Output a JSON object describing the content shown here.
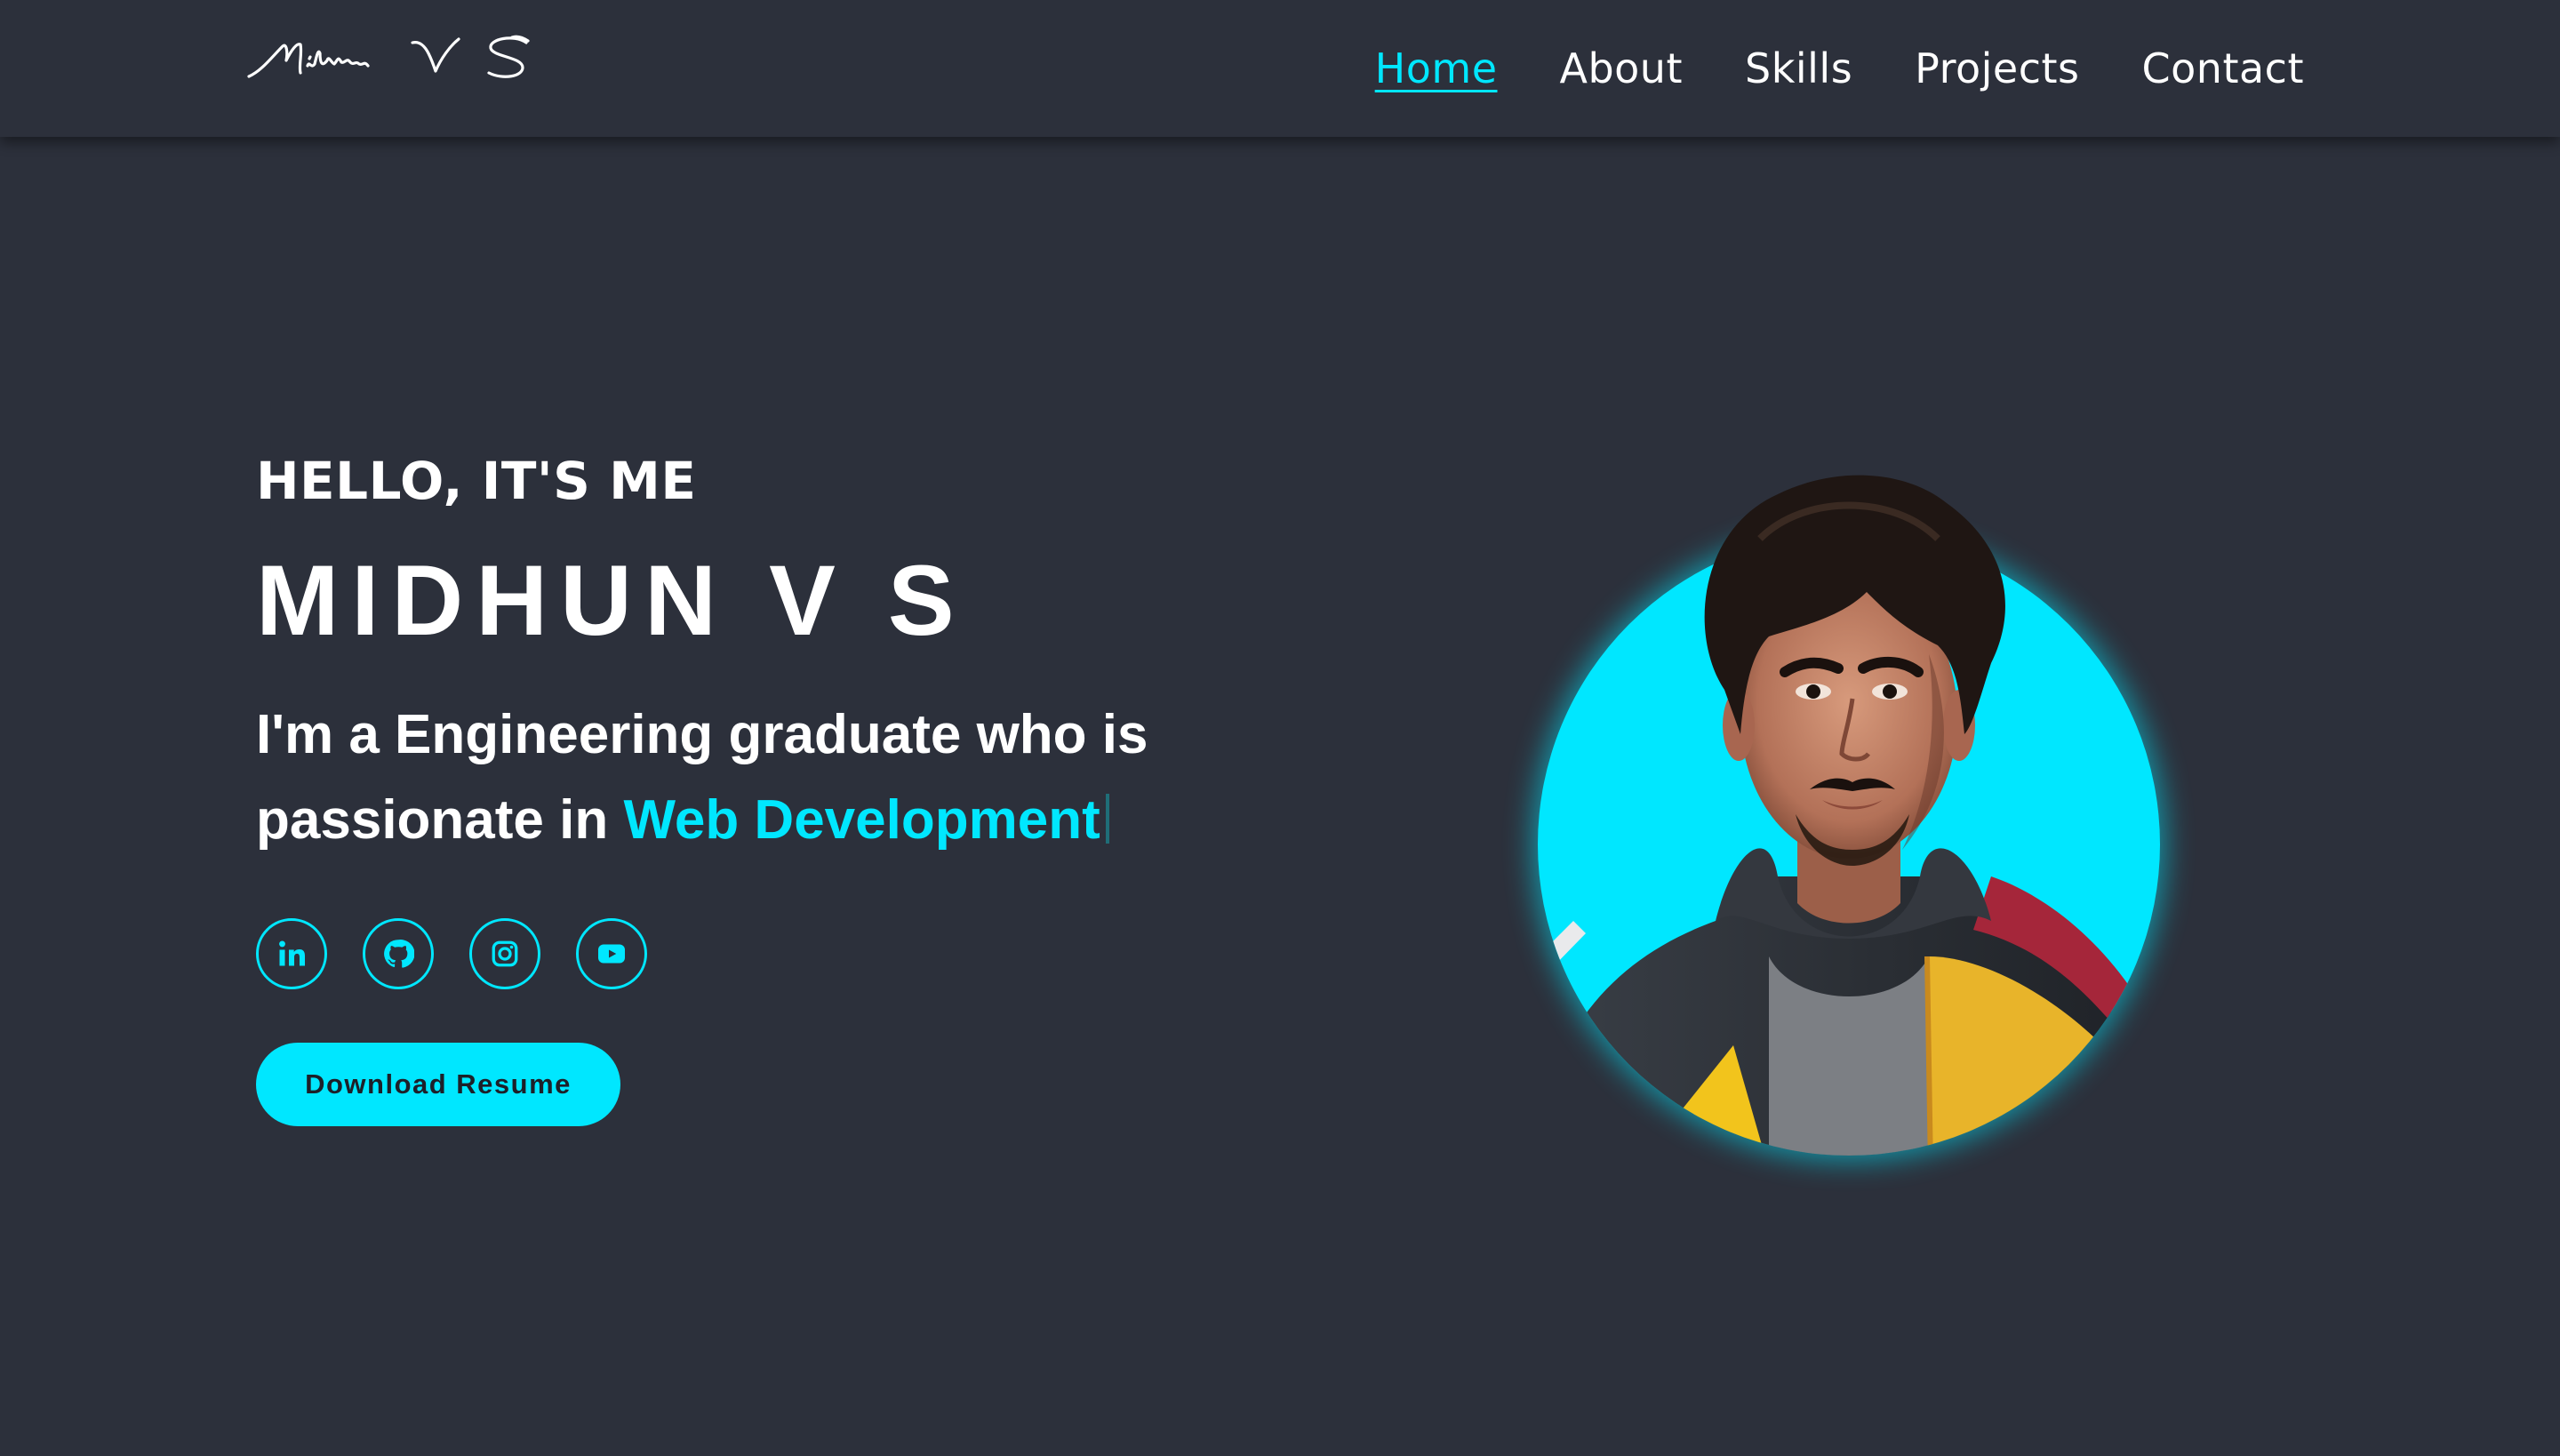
{
  "header": {
    "logo_text": "Midhun V S",
    "nav": [
      {
        "label": "Home",
        "active": true
      },
      {
        "label": "About",
        "active": false
      },
      {
        "label": "Skills",
        "active": false
      },
      {
        "label": "Projects",
        "active": false
      },
      {
        "label": "Contact",
        "active": false
      }
    ]
  },
  "hero": {
    "greeting": "HELLO, IT'S ME",
    "name": "MIDHUN V S",
    "tagline_prefix": "I'm a Engineering graduate who is passionate in ",
    "tagline_highlight": "Web Development",
    "socials": [
      {
        "name": "linkedin",
        "icon": "linkedin-icon"
      },
      {
        "name": "github",
        "icon": "github-icon"
      },
      {
        "name": "instagram",
        "icon": "instagram-icon"
      },
      {
        "name": "youtube",
        "icon": "youtube-icon"
      }
    ],
    "resume_button": "Download Resume"
  },
  "colors": {
    "background": "#2c303b",
    "accent": "#00e7ff",
    "text": "#ffffff"
  }
}
